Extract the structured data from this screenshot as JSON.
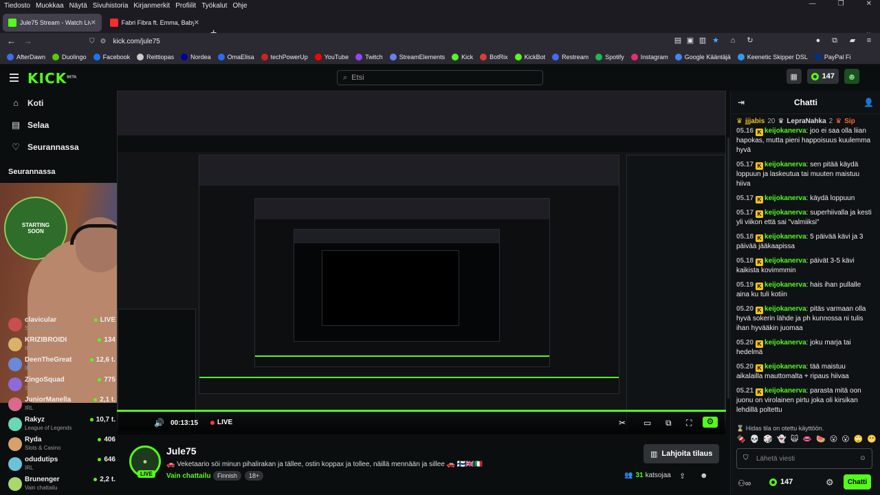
{
  "menubar": [
    "Tiedosto",
    "Muokkaa",
    "Näytä",
    "Sivuhistoria",
    "Kirjanmerkit",
    "Profiilit",
    "Työkalut",
    "Ohje"
  ],
  "tabs": [
    {
      "label": "Jule75 Stream - Watch Live on K",
      "color": "#53fc18"
    },
    {
      "label": "Fabri Fibra ft. Emma, Baby Gang",
      "color": "#ff2a2a"
    }
  ],
  "url": "kick.com/jule75",
  "bookmarks": [
    {
      "label": "AfterDawn",
      "color": "#3a6ff0"
    },
    {
      "label": "Duolingo",
      "color": "#58cc02"
    },
    {
      "label": "Facebook",
      "color": "#1877f2"
    },
    {
      "label": "Reittiopas",
      "color": "#cccccc"
    },
    {
      "label": "Nordea",
      "color": "#0000a0"
    },
    {
      "label": "OmaElisa",
      "color": "#2a6bf2"
    },
    {
      "label": "techPowerUp",
      "color": "#d32020"
    },
    {
      "label": "YouTube",
      "color": "#ff0000"
    },
    {
      "label": "Twitch",
      "color": "#9146ff"
    },
    {
      "label": "StreamElements",
      "color": "#6b7cff"
    },
    {
      "label": "Kick",
      "color": "#53fc18"
    },
    {
      "label": "BotRix",
      "color": "#e03a3a"
    },
    {
      "label": "KickBot",
      "color": "#53fc18"
    },
    {
      "label": "Restream",
      "color": "#3f6bff"
    },
    {
      "label": "Spotify",
      "color": "#1db954"
    },
    {
      "label": "Instagram",
      "color": "#e1306c"
    },
    {
      "label": "Google Kääntäjä",
      "color": "#4285f4"
    },
    {
      "label": "Keenetic Skipper DSL",
      "color": "#2a9df4"
    },
    {
      "label": "PayPal Fi",
      "color": "#003087"
    }
  ],
  "header": {
    "logo": "KICK",
    "logo_sup": "BETA",
    "search_placeholder": "Etsi",
    "points": "147"
  },
  "sidebar": {
    "nav": [
      "Koti",
      "Selaa",
      "Seurannassa"
    ],
    "following_title": "Seurannassa",
    "sticker_text": "STARTING SOON",
    "followers": [
      {
        "name": "clavicular",
        "category": "Slots & Casino",
        "viewers": "LIVE",
        "color": "#c94f4f"
      },
      {
        "name": "KRIZIBROIDI",
        "category": "IRL",
        "viewers": "134",
        "color": "#d9b36a"
      },
      {
        "name": "DeenTheGreat",
        "category": "IRL",
        "viewers": "12,6 t.",
        "color": "#6a8ad9"
      },
      {
        "name": "ZingoSquad",
        "category": "Slots & Casino",
        "viewers": "775",
        "color": "#8e6ad9"
      },
      {
        "name": "JuniorManella",
        "category": "IRL",
        "viewers": "2,1 t.",
        "color": "#d96a8e"
      },
      {
        "name": "Rakyz",
        "category": "League of Legends",
        "viewers": "10,7 t.",
        "color": "#6ad9b3"
      },
      {
        "name": "Ryda",
        "category": "Slots & Casino",
        "viewers": "406",
        "color": "#d9a06a"
      },
      {
        "name": "odudutips",
        "category": "IRL",
        "viewers": "646",
        "color": "#6ac4d9"
      },
      {
        "name": "Brunenger",
        "category": "Vain chattailu",
        "viewers": "2,2 t.",
        "color": "#a8d96a"
      }
    ]
  },
  "player": {
    "time": "00:13:15",
    "live": "LIVE"
  },
  "stream": {
    "channel": "Jule75",
    "title": "🚗 Veketaario söi minun pihalirakan ja tällee, ostin koppax ja tollee, näillä mennään ja sillee 🚗 🇫🇮🇬🇧🇮🇹",
    "category": "Vain chattailu",
    "tags": [
      "Finnish",
      "18+"
    ],
    "subscribe": "Lahjoita tilaus",
    "viewers": "31",
    "viewers_label": "katsojaa",
    "live_badge": "LIVE"
  },
  "chat": {
    "title": "Chatti",
    "pinned": [
      {
        "name": "jjjabis",
        "count": "20",
        "color": "#f5c518"
      },
      {
        "name": "LepraNahka",
        "count": "2",
        "color": "#dddddd"
      },
      {
        "name": "Sip",
        "count": "",
        "color": "#ff6a3a"
      }
    ],
    "messages": [
      {
        "ts": "05.16",
        "user": "keijokanerva",
        "text": "joo ei saa olla liian hapokas, mutta pieni happoisuus kuulemma hyvä"
      },
      {
        "ts": "05.17",
        "user": "keijokanerva",
        "text": "sen pitää käydä loppuun ja laskeutua tai muuten maistuu hiiva"
      },
      {
        "ts": "05.17",
        "user": "keijokanerva",
        "text": "käydä loppuun"
      },
      {
        "ts": "05.17",
        "user": "keijokanerva",
        "text": "superhiivalla ja kesti yli viikon että sai \"valmiiksi\""
      },
      {
        "ts": "05.18",
        "user": "keijokanerva",
        "text": "5 päivää kävi ja 3 päivää jääkaapissa"
      },
      {
        "ts": "05.18",
        "user": "keijokanerva",
        "text": "päivät 3-5 kävi kaikista kovimmmin"
      },
      {
        "ts": "05.19",
        "user": "keijokanerva",
        "text": "hais ihan pullalle aina ku tuli kotiin"
      },
      {
        "ts": "05.20",
        "user": "keijokanerva",
        "text": "pitäs varmaan olla hyvä sokerin lähde ja ph kunnossa ni tulis ihan hyvääkin juomaa"
      },
      {
        "ts": "05.20",
        "user": "keijokanerva",
        "text": "joku marja tai hedelmä"
      },
      {
        "ts": "05.20",
        "user": "keijokanerva",
        "text": "tää maistuu aikalailla mauttomalta + ripaus hiivaa"
      },
      {
        "ts": "05.21",
        "user": "keijokanerva",
        "text": "parasta mitä oon juonu on virolainen pirtu joka oli kirsikan lehdillä poltettu"
      }
    ],
    "hidden_note": "Hidas tila on otettu käyttöön.",
    "emotes": [
      "🍫",
      "💀",
      "🎲",
      "👻",
      "🙀",
      "👄",
      "🍉",
      "😮",
      "😮",
      "🙄",
      "😬"
    ],
    "input_placeholder": "Lähetä viesti",
    "points": "147",
    "send": "Chatti"
  }
}
